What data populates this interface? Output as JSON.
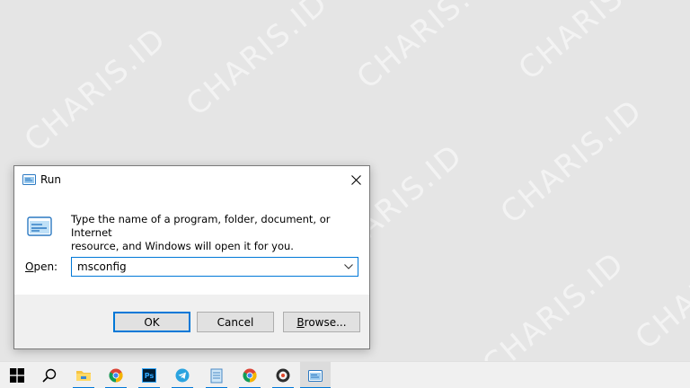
{
  "watermark": {
    "text": "CHARIS.ID"
  },
  "dialog": {
    "title": "Run",
    "prompt_line1": "Type the name of a program, folder, document, or Internet",
    "prompt_line2": "resource, and Windows will open it for you.",
    "open_label_underline": "O",
    "open_label_rest": "pen:",
    "open_value": "msconfig",
    "buttons": {
      "ok": "OK",
      "cancel": "Cancel",
      "browse_underline": "B",
      "browse_rest": "rowse..."
    }
  },
  "taskbar": {
    "items": [
      {
        "name": "start-button",
        "icon": "windows-logo-icon"
      },
      {
        "name": "search-button",
        "icon": "search-icon"
      },
      {
        "name": "file-explorer",
        "icon": "folder-icon"
      },
      {
        "name": "chrome",
        "icon": "chrome-icon"
      },
      {
        "name": "photoshop",
        "icon": "photoshop-icon",
        "label": "Ps"
      },
      {
        "name": "telegram",
        "icon": "telegram-icon"
      },
      {
        "name": "notepad",
        "icon": "notepad-icon"
      },
      {
        "name": "chrome-2",
        "icon": "chrome-icon"
      },
      {
        "name": "media-player",
        "icon": "media-player-icon"
      },
      {
        "name": "run",
        "icon": "run-icon"
      }
    ]
  },
  "colors": {
    "accent": "#0078d7",
    "desktop": "#e5e5e5",
    "taskbar": "#f0f0f0"
  }
}
